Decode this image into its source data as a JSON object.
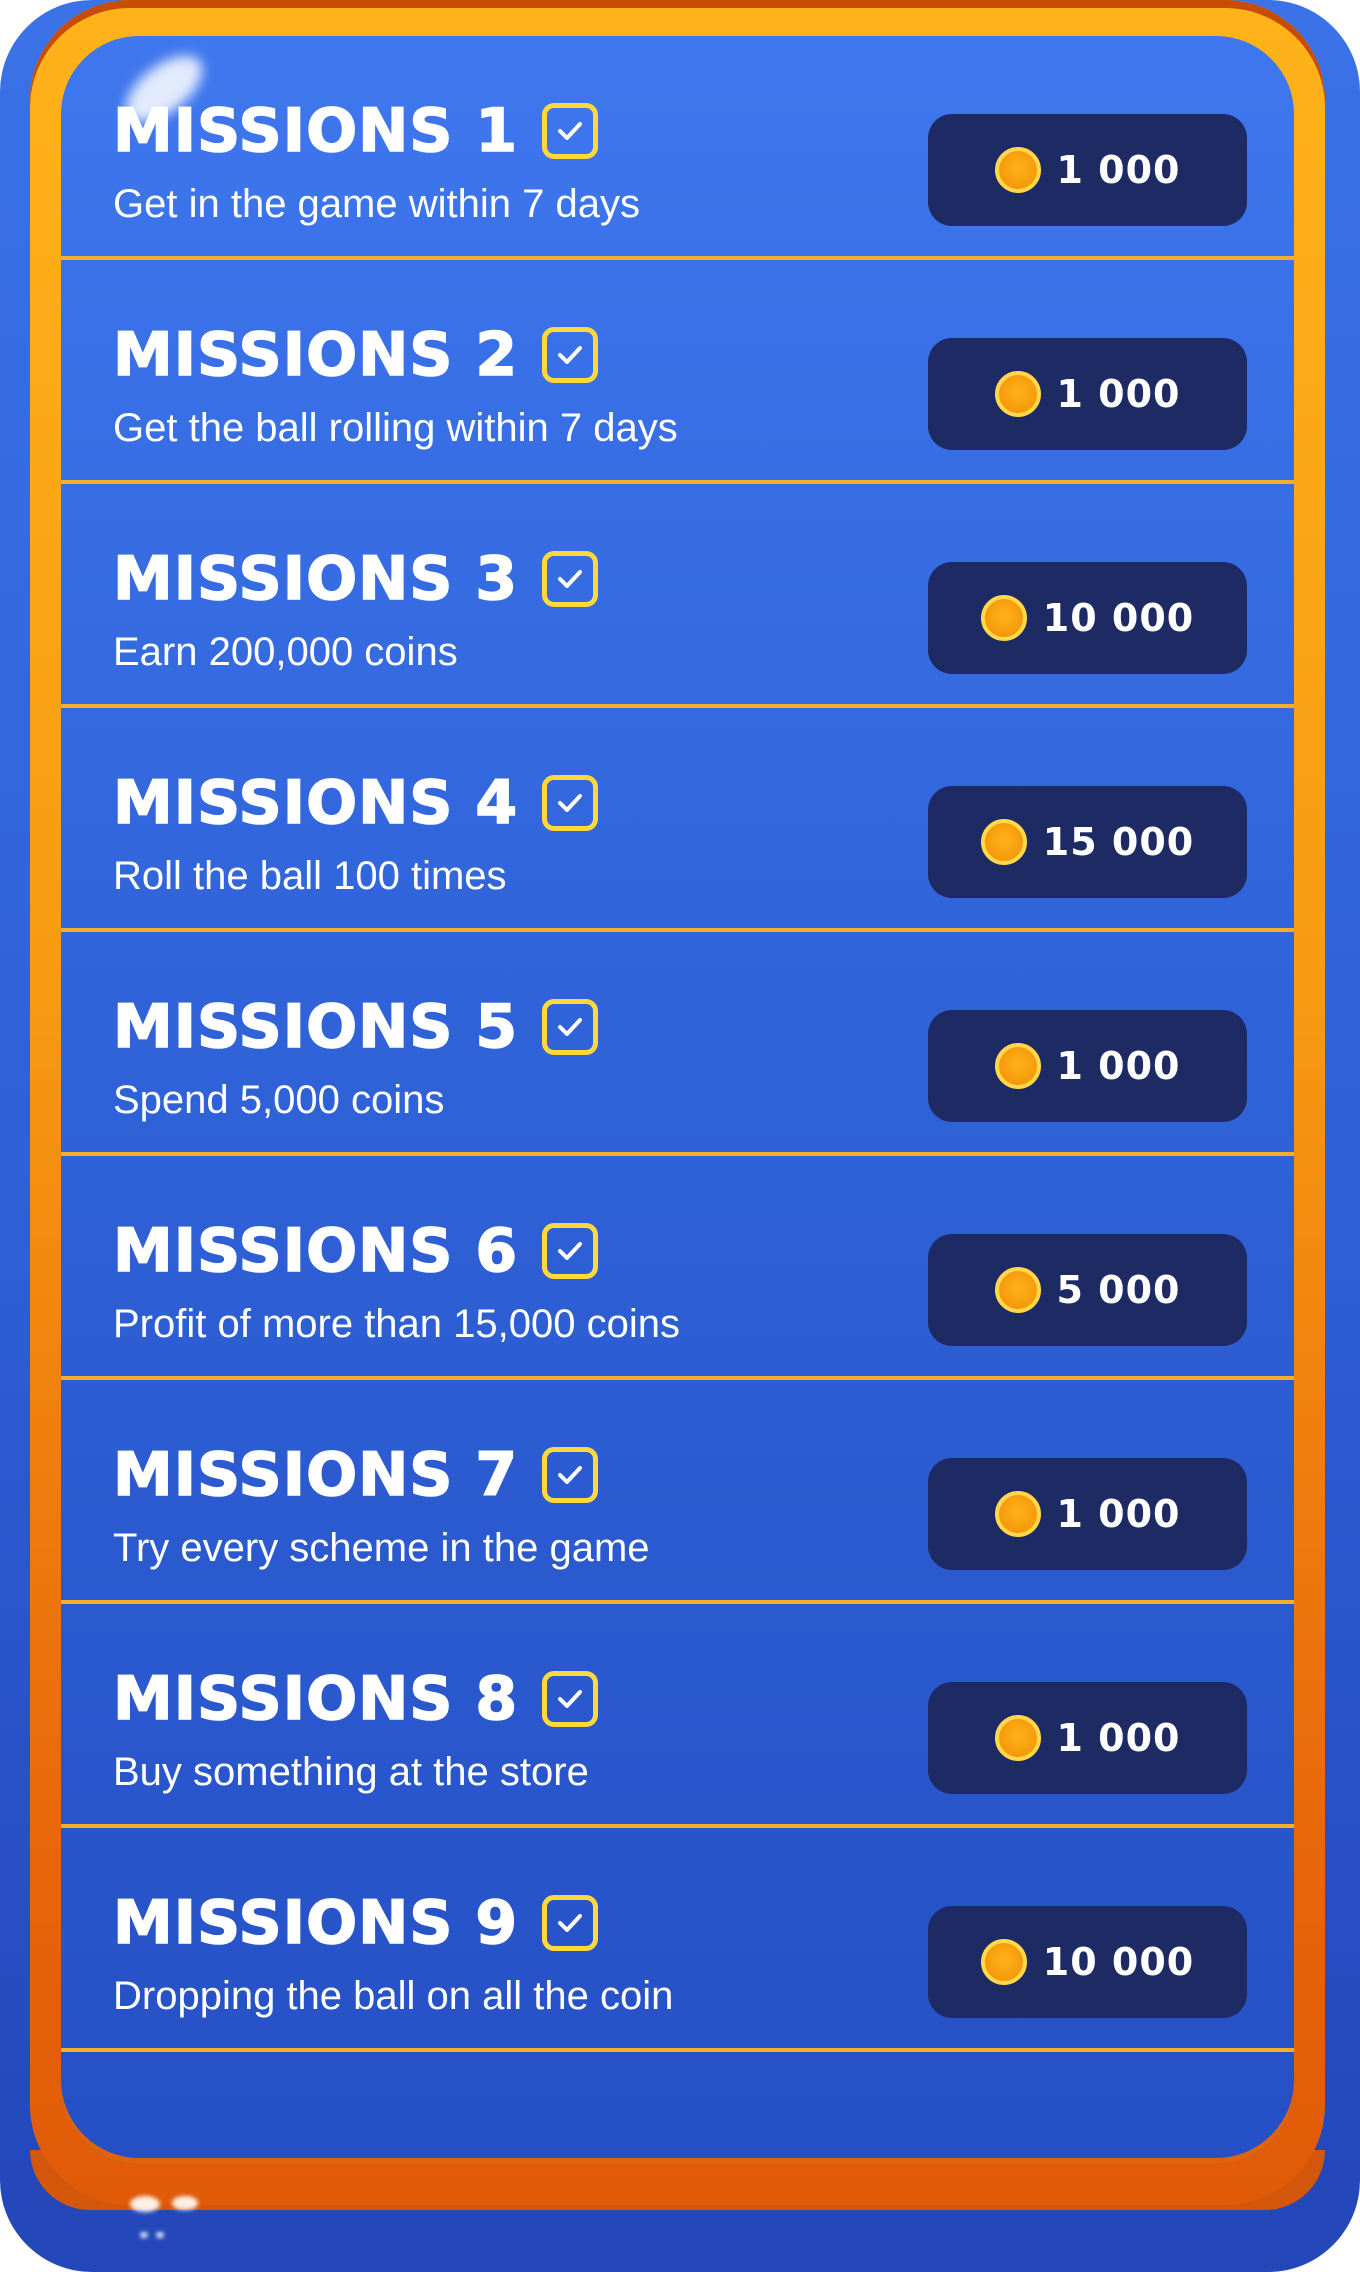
{
  "missions": [
    {
      "title": "MISSIONS 1",
      "description": "Get in the game within 7 days",
      "reward": "1 000"
    },
    {
      "title": "MISSIONS 2",
      "description": "Get the ball rolling within 7 days",
      "reward": "1 000"
    },
    {
      "title": "MISSIONS 3",
      "description": "Earn 200,000 coins",
      "reward": "10 000"
    },
    {
      "title": "MISSIONS 4",
      "description": "Roll the ball 100 times",
      "reward": "15 000"
    },
    {
      "title": "MISSIONS 5",
      "description": "Spend 5,000 coins",
      "reward": "1 000"
    },
    {
      "title": "MISSIONS 6",
      "description": "Profit of more than 15,000 coins",
      "reward": "5 000"
    },
    {
      "title": "MISSIONS 7",
      "description": "Try every scheme in the game",
      "reward": "1 000"
    },
    {
      "title": "MISSIONS 8",
      "description": "Buy something at the store",
      "reward": "1 000"
    },
    {
      "title": "MISSIONS 9",
      "description": "Dropping the ball on all the coin",
      "reward": "10 000"
    }
  ],
  "icons": {
    "check": "checkbox-checked-icon",
    "coin": "coin-icon"
  },
  "colors": {
    "frame": "#f79a12",
    "panel": "#3063d9",
    "divider": "#f2b227",
    "reward_bg": "#1d2a63",
    "check": "#ffd83a",
    "coin": "#f59b0b"
  }
}
